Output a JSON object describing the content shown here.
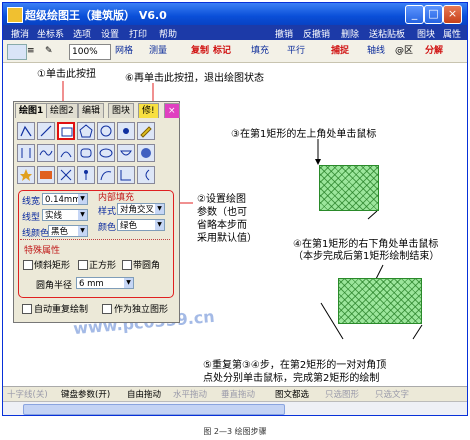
{
  "window": {
    "title": "超级绘图王（建筑版） V6.0",
    "controls": [
      "minimize-icon",
      "maximize-icon",
      "close-icon"
    ]
  },
  "menubar": {
    "items": [
      "撤消",
      "坐标系",
      "选项",
      "设置",
      "打印",
      "帮助",
      "撤销",
      "反撤销",
      "删除",
      "送粘贴板",
      "图块",
      "属性"
    ]
  },
  "toolbar": {
    "line_width": "100%",
    "grid": "网格",
    "measure": "测量",
    "copy": "复制",
    "mark": "标记",
    "fill": "填充",
    "parallel": "平行",
    "capture": "捕捉",
    "axis_line": "轴线",
    "wheel": "@区",
    "split": "分解"
  },
  "annotations": {
    "a1": "①单击此按扭",
    "a6": "⑥再单击此按扭，退出绘图状态",
    "a3": "③在第1矩形的左上角处单击鼠标",
    "a2_l1": "②设置绘图",
    "a2_l2": "参数（也可",
    "a2_l3": "省略本步而",
    "a2_l4": "采用默认值）",
    "a4_l1": "④在第1矩形的右下角处单击鼠标",
    "a4_l2": "（本步完成后第1矩形绘制结束）",
    "a5_l1": "⑤重复第③④步，在第2矩形的一对对角顶",
    "a5_l2": "点处分别单击鼠标，完成第2矩形的绘制"
  },
  "panel": {
    "tabs": [
      "绘图1",
      "绘图2",
      "编辑",
      "图块",
      "修!",
      "×"
    ],
    "line_width_label": "线宽",
    "line_width_value": "0.14mm",
    "line_type_label": "线型",
    "line_type_value": "实线",
    "line_color_label": "线颜色",
    "line_color_value": "黑色",
    "fill_heading": "内部填充",
    "style_label": "样式",
    "style_value": "对角交叉",
    "fill_color_label": "颜色",
    "fill_color_value": "绿色",
    "special_heading": "特殊属性",
    "tilt_rect": "倾斜矩形",
    "square": "正方形",
    "rounded": "带圆角",
    "radius_label": "圆角半径",
    "radius_value": "6 mm",
    "auto_repeat": "自动重复绘制",
    "as_independent": "作为独立图形"
  },
  "watermark": "www.pc0359.cn",
  "statusbar": {
    "items": [
      "十字线(关)",
      "键盘参数(开)",
      "自由拖动",
      "水平拖动",
      "垂直拖动",
      "图文都选",
      "只选图形",
      "只选文字"
    ]
  },
  "caption": "图 2—3    绘图步骤",
  "colors": {
    "title_blue": "#0a4fd8",
    "menu_blue": "#1c3aa8",
    "annot_red": "#e02020",
    "hatch_green": "#9ce69c"
  }
}
